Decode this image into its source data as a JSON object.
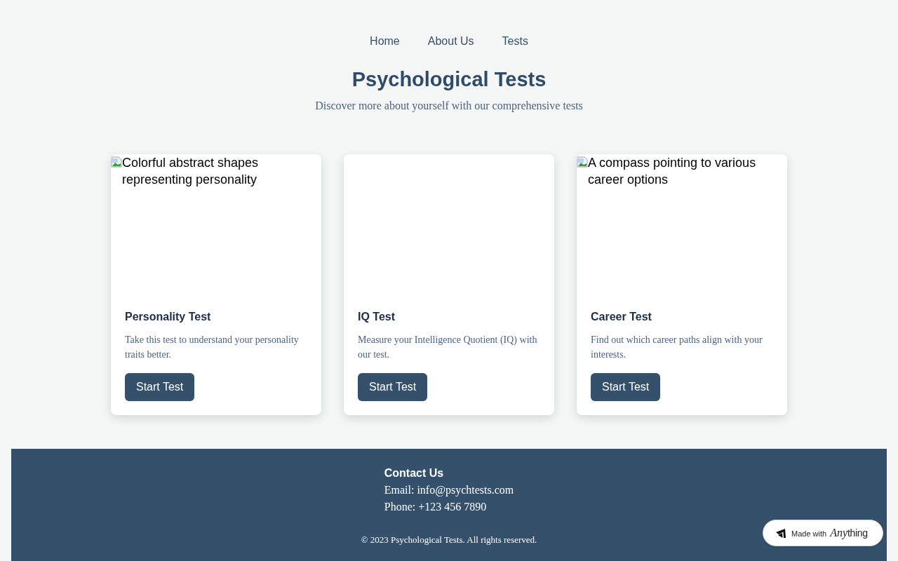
{
  "nav": {
    "links": [
      "Home",
      "About Us",
      "Tests"
    ]
  },
  "hero": {
    "title": "Psychological Tests",
    "subtitle": "Discover more about yourself with our comprehensive tests"
  },
  "cards": [
    {
      "image_alt": "Colorful abstract shapes representing personality",
      "title": "Personality Test",
      "description": "Take this test to understand your personality traits better.",
      "button": "Start Test"
    },
    {
      "title": "IQ Test",
      "description": "Measure your Intelligence Quotient (IQ) with our test.",
      "button": "Start Test"
    },
    {
      "image_alt": "A compass pointing to various career options",
      "title": "Career Test",
      "description": "Find out which career paths align with your interests.",
      "button": "Start Test"
    }
  ],
  "footer": {
    "contact_title": "Contact Us",
    "email": "Email: info@psychtests.com",
    "phone": "Phone: +123 456 7890",
    "copyright": "© 2023 Psychological Tests. All rights reserved."
  },
  "badge": {
    "text": "Made with",
    "brand_italic": "Any",
    "brand_rest": "thing"
  }
}
